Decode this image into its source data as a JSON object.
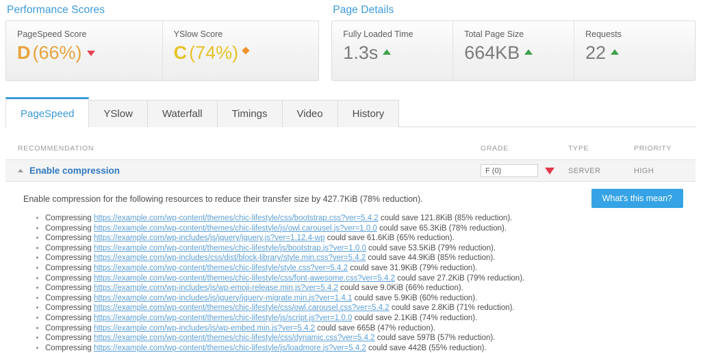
{
  "performance": {
    "title": "Performance Scores",
    "metrics": [
      {
        "label": "PageSpeed Score",
        "grade": "D",
        "percent": "(66%)",
        "indicator": "triangle-down-red-icon"
      },
      {
        "label": "YSlow Score",
        "grade": "C",
        "percent": "(74%)",
        "indicator": "diamond-orange-icon"
      }
    ]
  },
  "page_details": {
    "title": "Page Details",
    "metrics": [
      {
        "label": "Fully Loaded Time",
        "value": "1.3s",
        "indicator": "triangle-up-green-icon"
      },
      {
        "label": "Total Page Size",
        "value": "664KB",
        "indicator": "triangle-up-green-icon"
      },
      {
        "label": "Requests",
        "value": "22",
        "indicator": "triangle-up-green-icon"
      }
    ]
  },
  "tabs": [
    {
      "label": "PageSpeed",
      "active": true
    },
    {
      "label": "YSlow",
      "active": false
    },
    {
      "label": "Waterfall",
      "active": false
    },
    {
      "label": "Timings",
      "active": false
    },
    {
      "label": "Video",
      "active": false
    },
    {
      "label": "History",
      "active": false
    }
  ],
  "table": {
    "headers": {
      "recommendation": "RECOMMENDATION",
      "grade": "GRADE",
      "type": "TYPE",
      "priority": "PRIORITY"
    },
    "row": {
      "title": "Enable compression",
      "grade": "F (0)",
      "type": "SERVER",
      "priority": "HIGH"
    }
  },
  "detail": {
    "lead": "Enable compression for the following resources to reduce their transfer size by 427.7KiB (78% reduction).",
    "button_label": "What's this mean?",
    "items": [
      {
        "prefix": "Compressing ",
        "url": "https://example.com/wp-content/themes/chic-lifestyle/css/bootstrap.css?ver=5.4.2",
        "suffix": " could save 121.8KiB (85% reduction)."
      },
      {
        "prefix": "Compressing ",
        "url": "https://example.com/wp-content/themes/chic-lifestyle/js/owl.carousel.js?ver=1.0.0",
        "suffix": " could save 65.3KiB (78% reduction)."
      },
      {
        "prefix": "Compressing ",
        "url": "https://example.com/wp-includes/js/jquery/jquery.js?ver=1.12.4-wp",
        "suffix": " could save 61.6KiB (65% reduction)."
      },
      {
        "prefix": "Compressing ",
        "url": "https://example.com/wp-content/themes/chic-lifestyle/js/bootstrap.js?ver=1.0.0",
        "suffix": " could save 53.5KiB (79% reduction)."
      },
      {
        "prefix": "Compressing ",
        "url": "https://example.com/wp-includes/css/dist/block-library/style.min.css?ver=5.4.2",
        "suffix": " could save 44.9KiB (85% reduction)."
      },
      {
        "prefix": "Compressing ",
        "url": "https://example.com/wp-content/themes/chic-lifestyle/style.css?ver=5.4.2",
        "suffix": " could save 31.9KiB (79% reduction)."
      },
      {
        "prefix": "Compressing ",
        "url": "https://example.com/wp-content/themes/chic-lifestyle/css/font-awesome.css?ver=5.4.2",
        "suffix": " could save 27.2KiB (79% reduction)."
      },
      {
        "prefix": "Compressing ",
        "url": "https://example.com/wp-includes/js/wp-emoji-release.min.js?ver=5.4.2",
        "suffix": " could save 9.0KiB (66% reduction)."
      },
      {
        "prefix": "Compressing ",
        "url": "https://example.com/wp-includes/js/jquery/jquery-migrate.min.js?ver=1.4.1",
        "suffix": " could save 5.9KiB (60% reduction)."
      },
      {
        "prefix": "Compressing ",
        "url": "https://example.com/wp-content/themes/chic-lifestyle/css/owl.carousel.css?ver=5.4.2",
        "suffix": " could save 2.8KiB (71% reduction)."
      },
      {
        "prefix": "Compressing ",
        "url": "https://example.com/wp-content/themes/chic-lifestyle/js/script.js?ver=1.0.0",
        "suffix": " could save 2.1KiB (74% reduction)."
      },
      {
        "prefix": "Compressing ",
        "url": "https://example.com/wp-includes/js/wp-embed.min.js?ver=5.4.2",
        "suffix": " could save 665B (47% reduction)."
      },
      {
        "prefix": "Compressing ",
        "url": "https://example.com/wp-content/themes/chic-lifestyle/css/dynamic.css?ver=5.4.2",
        "suffix": " could save 597B (57% reduction)."
      },
      {
        "prefix": "Compressing ",
        "url": "https://example.com/wp-content/themes/chic-lifestyle/js/loadmore.js?ver=5.4.2",
        "suffix": " could save 442B (55% reduction)."
      }
    ]
  },
  "colors": {
    "accent_blue": "#3a9ad9",
    "button_blue": "#35a3e5",
    "link_blue": "#5b9fd6",
    "grade_d": "#e8a33d",
    "grade_c": "#e6c229",
    "down_red": "#e0384a",
    "up_green": "#3ea24a"
  }
}
